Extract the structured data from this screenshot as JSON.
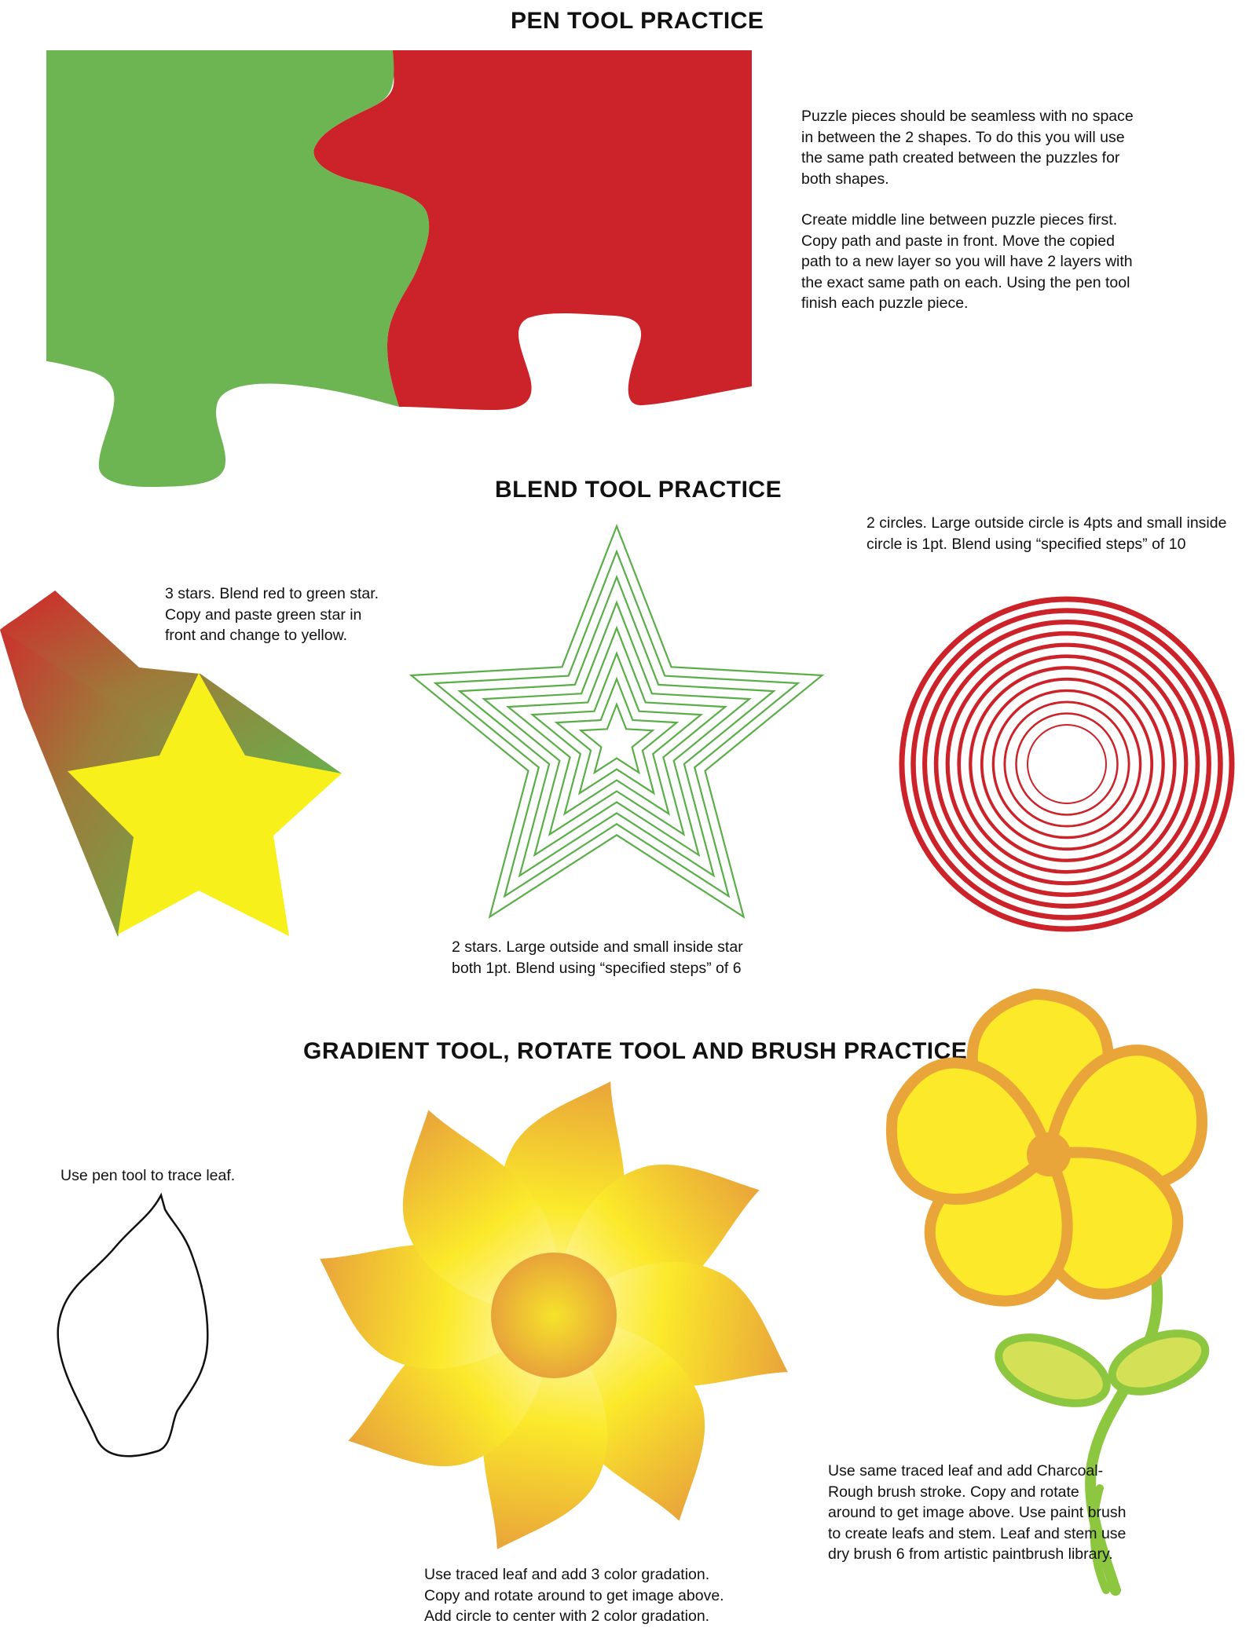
{
  "sections": {
    "pen": {
      "title": "PEN TOOL PRACTICE",
      "note1": [
        "Puzzle pieces should be seamless with no space",
        "in between the 2 shapes. To do this you will use",
        "the same path created between the puzzles for",
        "both shapes."
      ],
      "note2": [
        "Create middle line between puzzle pieces first.",
        "Copy path and paste in front. Move the copied",
        "path to a new layer so you will have 2 layers with",
        "the exact same path on each. Using the pen tool",
        "finish each puzzle piece."
      ]
    },
    "blend": {
      "title": "BLEND TOOL PRACTICE",
      "stars_note": [
        "3 stars. Blend red to green star.",
        "Copy and paste green star in",
        "front and change to yellow."
      ],
      "outline_star_note": [
        "2 stars. Large outside and small inside star",
        "both 1pt. Blend using “specified steps” of 6"
      ],
      "circles_note": [
        "2 circles. Large outside circle is 4pts and small inside",
        "circle is 1pt. Blend using “specified steps” of 10"
      ]
    },
    "gradient": {
      "title": "GRADIENT TOOL, ROTATE TOOL AND BRUSH PRACTICE",
      "leaf_note": [
        "Use pen tool to trace leaf."
      ],
      "gradient_flower_note": [
        "Use traced leaf and add 3 color gradation.",
        "Copy and rotate around to get image above.",
        "Add circle to center with 2 color gradation."
      ],
      "brush_flower_note": [
        "Use same traced leaf and add Charcoal-",
        "Rough brush stroke. Copy and rotate",
        "around to get image above.  Use paint brush",
        "to create leafs and stem. Leaf and stem use",
        "dry brush 6 from artistic paintbrush library."
      ]
    }
  },
  "colors": {
    "puzzle_green": "#6db452",
    "puzzle_red": "#cc2229",
    "star_yellow": "#f7f01b",
    "outline_green": "#5aae48",
    "ring_red": "#cc2229",
    "flower_yellow": "#fbe92a",
    "flower_orange": "#e9a43a",
    "leaf_green": "#8dc63f"
  },
  "steps": {
    "outline_star_count": 8,
    "circle_ring_count": 12
  }
}
